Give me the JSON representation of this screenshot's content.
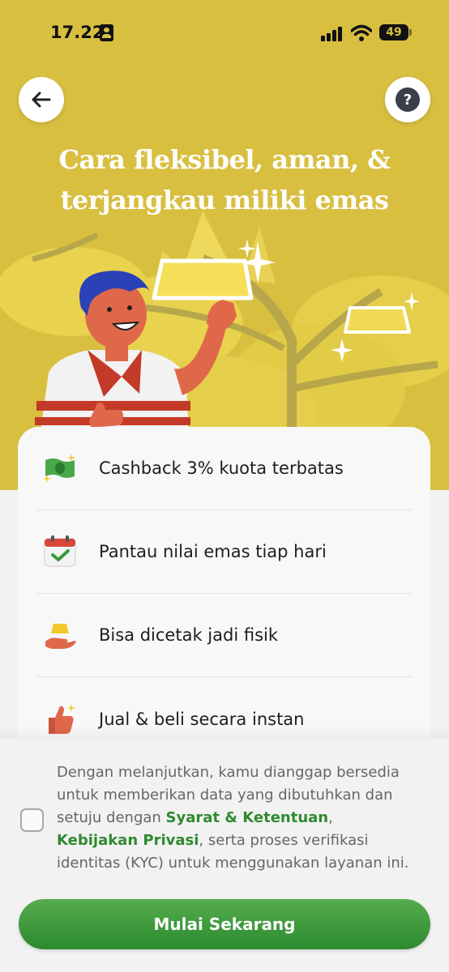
{
  "status_bar": {
    "time": "17.22",
    "battery": "49"
  },
  "header": {
    "title_line1": "Cara fleksibel, aman, &",
    "title_line2": "terjangkau miliki emas",
    "back_icon": "arrow-left-icon",
    "help_icon": "question-icon"
  },
  "benefits": [
    {
      "icon": "cash-icon",
      "label": "Cashback 3% kuota terbatas"
    },
    {
      "icon": "calendar-check-icon",
      "label": "Pantau nilai emas tiap hari"
    },
    {
      "icon": "gold-hand-icon",
      "label": "Bisa dicetak jadi fisik"
    },
    {
      "icon": "thumbs-up-icon",
      "label": "Jual & beli secara instan"
    }
  ],
  "consent": {
    "text_before": "Dengan melanjutkan, kamu dianggap bersedia untuk memberikan data yang dibutuhkan dan setuju dengan ",
    "terms_link": "Syarat & Ketentuan",
    "separator": ", ",
    "privacy_link": "Kebijakan Privasi",
    "text_after": ", serta proses verifikasi identitas (KYC) untuk menggunakan layanan ini.",
    "checked": false
  },
  "cta": {
    "label": "Mulai Sekarang"
  },
  "colors": {
    "hero_background": "#d8bf40",
    "accent_green": "#2f8a2f",
    "card_background": "#f8f8f8"
  }
}
